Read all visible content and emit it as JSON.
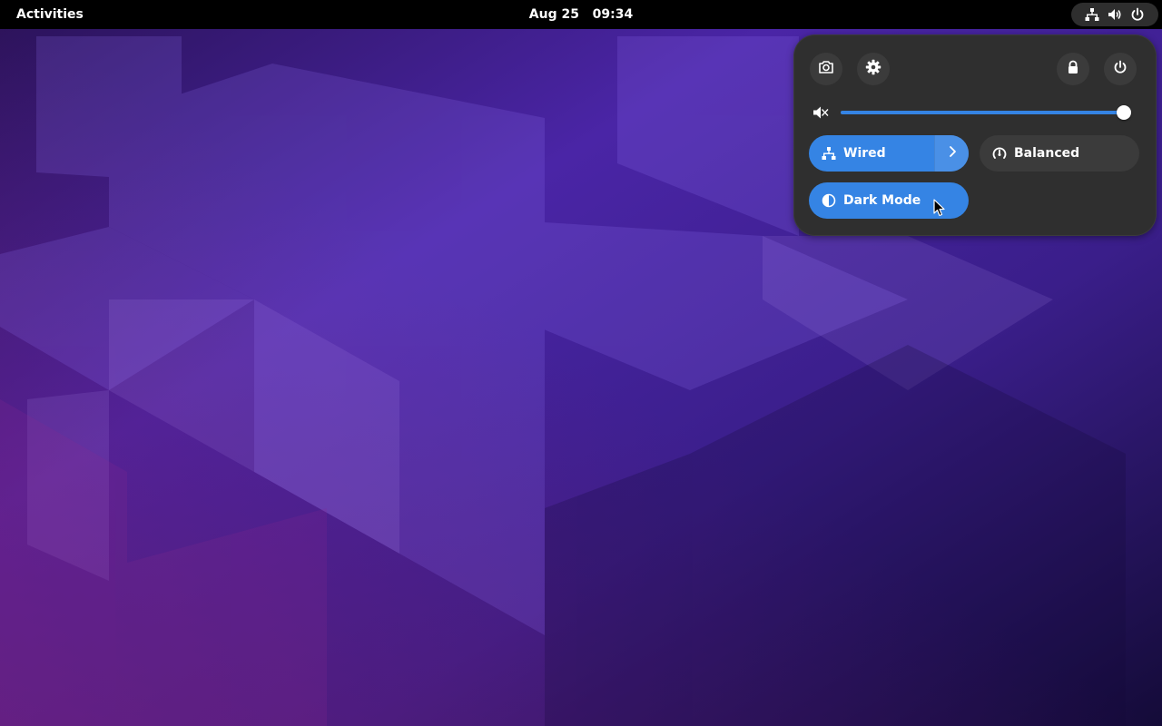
{
  "topbar": {
    "activities_label": "Activities",
    "clock_date": "Aug 25",
    "clock_time": "09:34",
    "indicators": [
      "network-wired-icon",
      "volume-icon",
      "power-icon"
    ]
  },
  "quick_settings": {
    "buttons": [
      "screenshot-icon",
      "settings-gear-icon",
      "lock-icon",
      "power-icon"
    ],
    "volume": {
      "muted": true,
      "level": 1.0
    },
    "toggles": {
      "wired": {
        "label": "Wired",
        "active": true
      },
      "power_mode": {
        "label": "Balanced",
        "active": false
      },
      "dark_mode": {
        "label": "Dark Mode",
        "active": true
      }
    }
  },
  "colors": {
    "accent": "#3584e4",
    "panel_bg": "#2f2f2f",
    "topbar_bg": "#000000"
  }
}
